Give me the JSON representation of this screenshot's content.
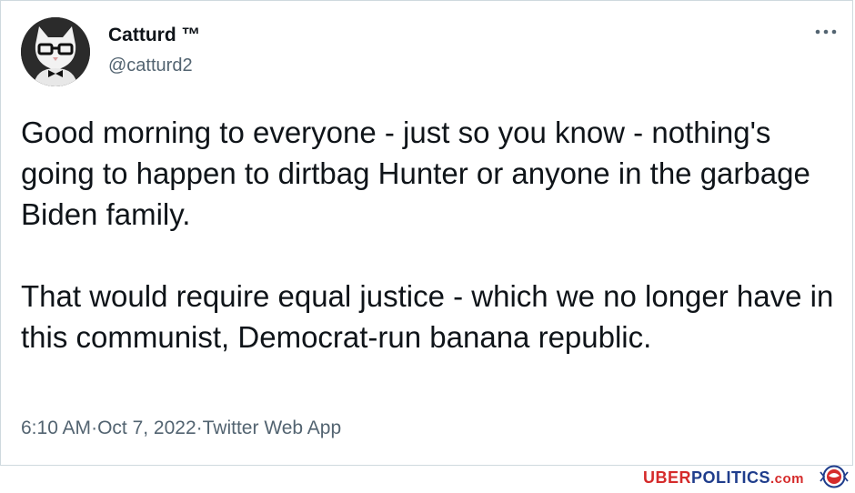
{
  "tweet": {
    "display_name": "Catturd ™",
    "handle": "@catturd2",
    "paragraphs": [
      "Good morning to everyone - just so you know - nothing's going to happen to dirtbag Hunter or anyone in the garbage Biden family.",
      "That would require equal justice - which we no longer have in this communist, Democrat-run banana republic."
    ],
    "time": "6:10 AM",
    "date": "Oct 7, 2022",
    "source": "Twitter Web App",
    "separator": " · "
  },
  "icons": {
    "avatar": "cat-with-glasses-avatar",
    "more": "more-options-icon",
    "logo": "uberpolitics-logo"
  },
  "watermark": {
    "part1": "UBER",
    "part2": "POLITICS",
    "part3": ".com"
  },
  "colors": {
    "text": "#0f1419",
    "secondary": "#536471",
    "border": "#cfd9de",
    "watermark_red": "#d52b2b",
    "watermark_blue": "#1f3d8c"
  }
}
